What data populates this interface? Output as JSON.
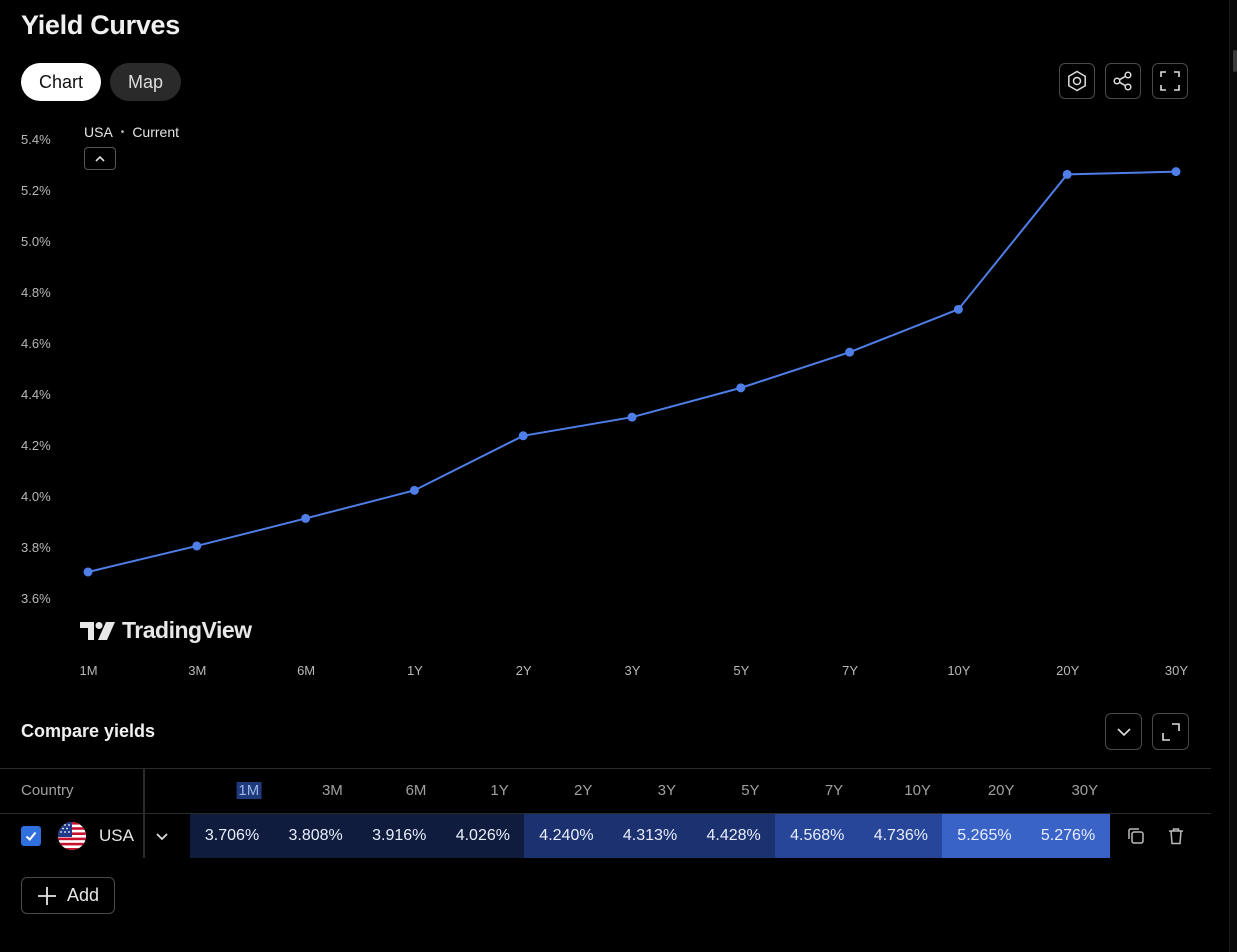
{
  "page": {
    "title": "Yield Curves"
  },
  "tabs": [
    {
      "label": "Chart",
      "active": true
    },
    {
      "label": "Map",
      "active": false
    }
  ],
  "toolbar": {
    "icons": [
      "settings-icon",
      "share-icon",
      "fullscreen-icon"
    ]
  },
  "legend": {
    "country": "USA",
    "separator": "•",
    "mode": "Current"
  },
  "watermark": "TradingView",
  "chart_data": {
    "type": "line",
    "categories": [
      "1M",
      "3M",
      "6M",
      "1Y",
      "2Y",
      "3Y",
      "5Y",
      "7Y",
      "10Y",
      "20Y",
      "30Y"
    ],
    "series": [
      {
        "name": "USA",
        "values": [
          3.706,
          3.808,
          3.916,
          4.026,
          4.24,
          4.313,
          4.428,
          4.568,
          4.736,
          5.265,
          5.276
        ]
      }
    ],
    "y_ticks": [
      "5.4%",
      "5.2%",
      "5.0%",
      "4.8%",
      "4.6%",
      "4.4%",
      "4.2%",
      "4.0%",
      "3.8%",
      "3.6%"
    ],
    "ylim": [
      3.6,
      5.4
    ],
    "color": "#4f7ee8",
    "grid": false
  },
  "compare": {
    "title": "Compare yields",
    "header": {
      "country": "Country",
      "columns": [
        "1M",
        "3M",
        "6M",
        "1Y",
        "2Y",
        "3Y",
        "5Y",
        "7Y",
        "10Y",
        "20Y",
        "30Y"
      ]
    },
    "rows": [
      {
        "checked": true,
        "country": "USA",
        "values": [
          "3.706%",
          "3.808%",
          "3.916%",
          "4.026%",
          "4.240%",
          "4.313%",
          "4.428%",
          "4.568%",
          "4.736%",
          "5.265%",
          "5.276%"
        ],
        "shades": [
          "#0f1c3d",
          "#0f1c3d",
          "#0f1c3d",
          "#0f1c3d",
          "#1c3270",
          "#1c3270",
          "#1c3270",
          "#27469a",
          "#27469a",
          "#3a63c8",
          "#3a63c8"
        ]
      }
    ],
    "add_label": "Add"
  }
}
